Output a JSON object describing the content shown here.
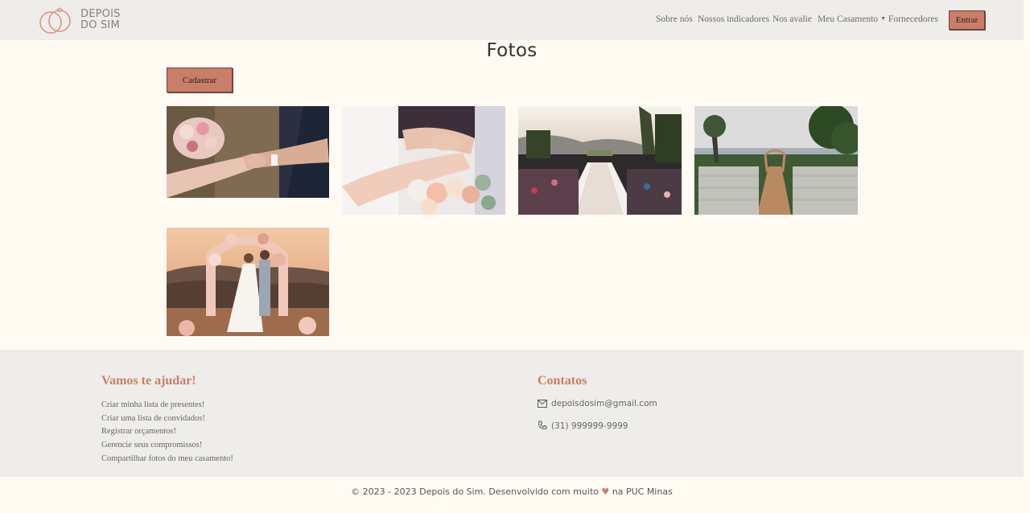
{
  "brand": {
    "line1": "DEPOIS",
    "line2": "DO SIM"
  },
  "nav": {
    "items": [
      "Sobre nós",
      "Nossos indicadores",
      "Nos avalie",
      "Meu Casamento",
      "Fornecedores"
    ],
    "login": "Entrar"
  },
  "main": {
    "title": "Fotos",
    "register_button": "Cadastrar",
    "photos": [
      {
        "subject": "hands-ring-bouquet-dark"
      },
      {
        "subject": "hands-rings-bouquet-white"
      },
      {
        "subject": "outdoor-ceremony-crowd"
      },
      {
        "subject": "empty-ceremony-aisle"
      },
      {
        "subject": "couple-flower-arch-sunset"
      }
    ]
  },
  "footer": {
    "help": {
      "title": "Vamos te ajudar!",
      "items": [
        "Criar minha lista de presentes!",
        "Criar uma lista de convidados!",
        "Registrar orçamentos!",
        "Gerencie seus compromissos!",
        "Compartilhar fotos do meu casamento!"
      ]
    },
    "contacts": {
      "title": "Contatos",
      "email": "depoisdosim@gmail.com",
      "phone": "(31) 999999-9999"
    }
  },
  "copyright": {
    "before": "© 2023 - 2023 Depois do Sim. Desenvolvido com muito",
    "after": "na PUC Minas"
  },
  "colors": {
    "accent": "#c97e67",
    "navbar_bg": "#efedea",
    "page_bg": "#fffbf3"
  }
}
